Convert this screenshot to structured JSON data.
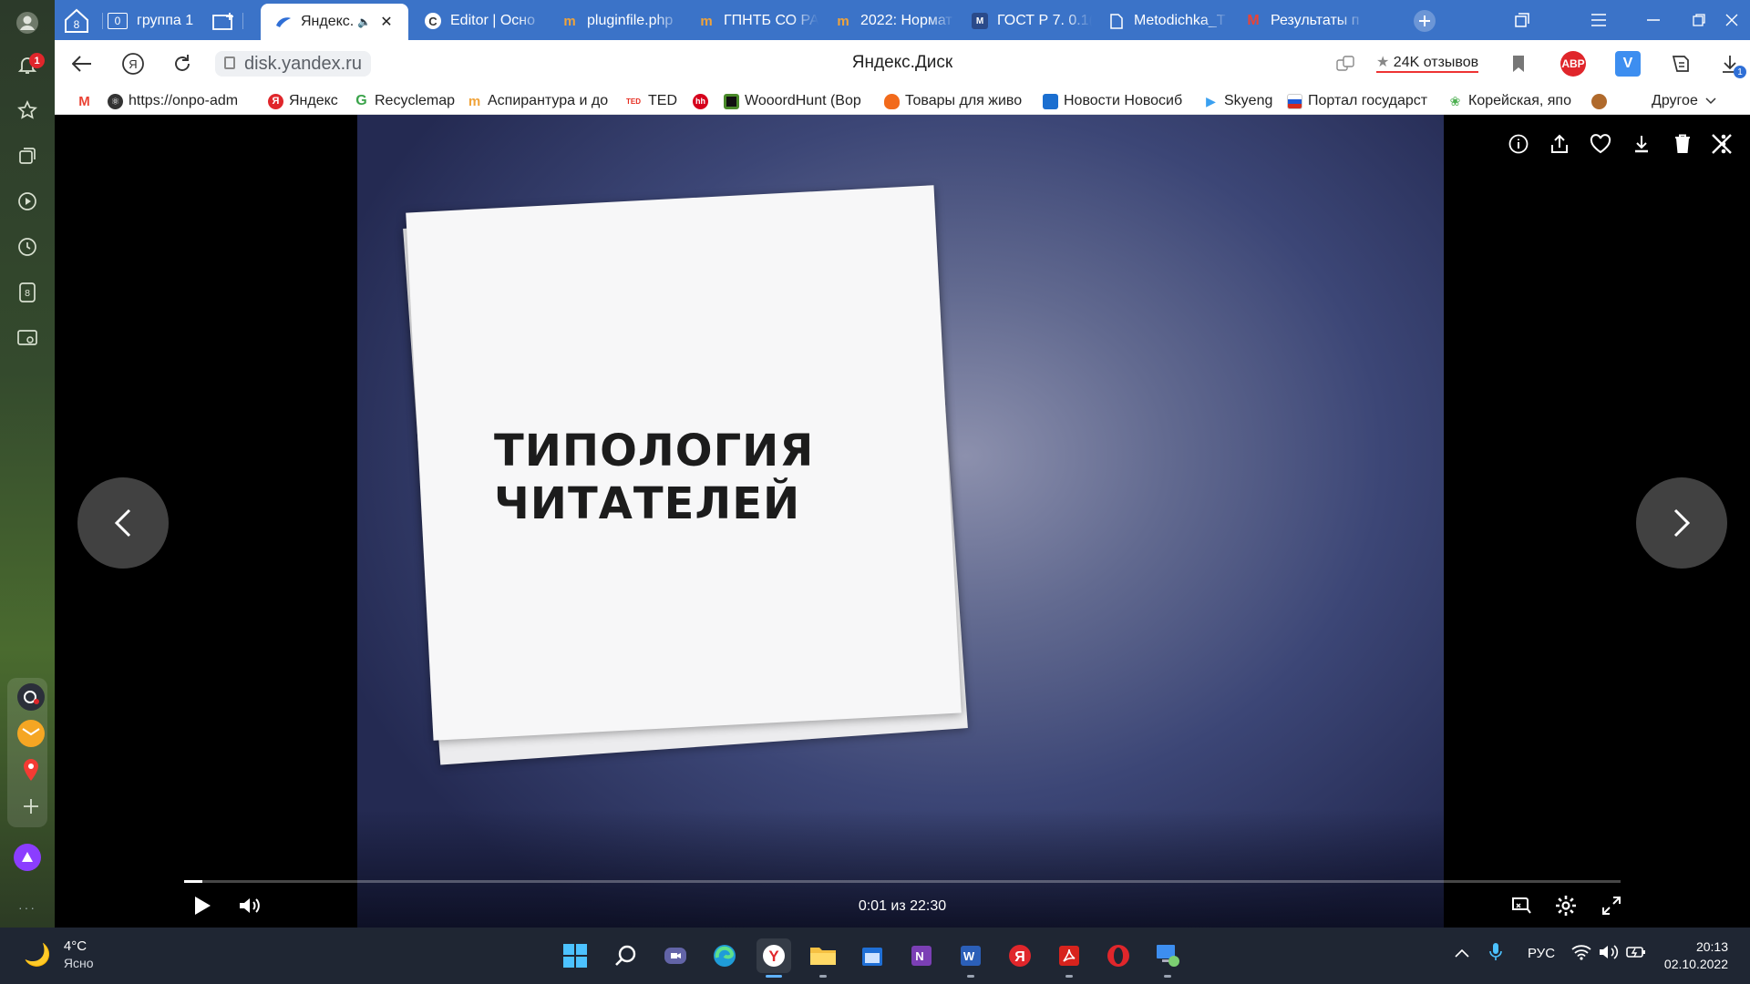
{
  "sidebar": {
    "notification_count": "1",
    "icons": [
      "bell-icon",
      "star-icon",
      "collections-icon",
      "video-icon",
      "history-icon",
      "downloads-icon",
      "screenshot-icon"
    ],
    "apps": [
      "messenger-icon",
      "mail-icon",
      "maps-icon",
      "add-icon"
    ],
    "alice": "alice-icon"
  },
  "tabs": {
    "counter": "8",
    "group_count": "0",
    "group_label": "группа 1",
    "items": [
      {
        "label": "Яндекс.",
        "active": true
      },
      {
        "label": "Editor | Осно",
        "active": false
      },
      {
        "label": "pluginfile.php",
        "active": false
      },
      {
        "label": "ГПНТБ СО РА",
        "active": false
      },
      {
        "label": "2022: Нормат",
        "active": false
      },
      {
        "label": "ГОСТ Р 7. 0.1(",
        "active": false
      },
      {
        "label": "Metodichka_T",
        "active": false
      },
      {
        "label": "Результаты п",
        "active": false
      }
    ]
  },
  "address": {
    "url": "disk.yandex.ru",
    "page_title": "Яндекс.Диск",
    "reviews": "24K отзывов",
    "abp_label": "ABP",
    "v_label": "V",
    "downloads_count": "1"
  },
  "bookmarks": [
    {
      "label": ""
    },
    {
      "label": "https://onpo-adm"
    },
    {
      "label": "Яндекс"
    },
    {
      "label": "Recyclemap"
    },
    {
      "label": "Аспирантура и до"
    },
    {
      "label": "TED"
    },
    {
      "label": ""
    },
    {
      "label": "WooordHunt (Вор"
    },
    {
      "label": "Товары для живо"
    },
    {
      "label": "Новости Новосиб"
    },
    {
      "label": "Skyeng"
    },
    {
      "label": "Портал государст"
    },
    {
      "label": "Корейская, япо"
    },
    {
      "label": ""
    }
  ],
  "bookmarks_other": "Другое",
  "viewer": {
    "slide_title_line1": "ТИПОЛОГИЯ",
    "slide_title_line2": "ЧИТАТЕЛЕЙ",
    "time_display": "0:01 из 22:30",
    "progress_fraction": 0.0008,
    "tools": [
      "info-icon",
      "share-icon",
      "favorite-icon",
      "download-icon",
      "delete-icon",
      "more-icon",
      "close-icon"
    ]
  },
  "taskbar": {
    "temperature": "4°C",
    "weather": "Ясно",
    "language": "РУС",
    "time": "20:13",
    "date": "02.10.2022"
  }
}
